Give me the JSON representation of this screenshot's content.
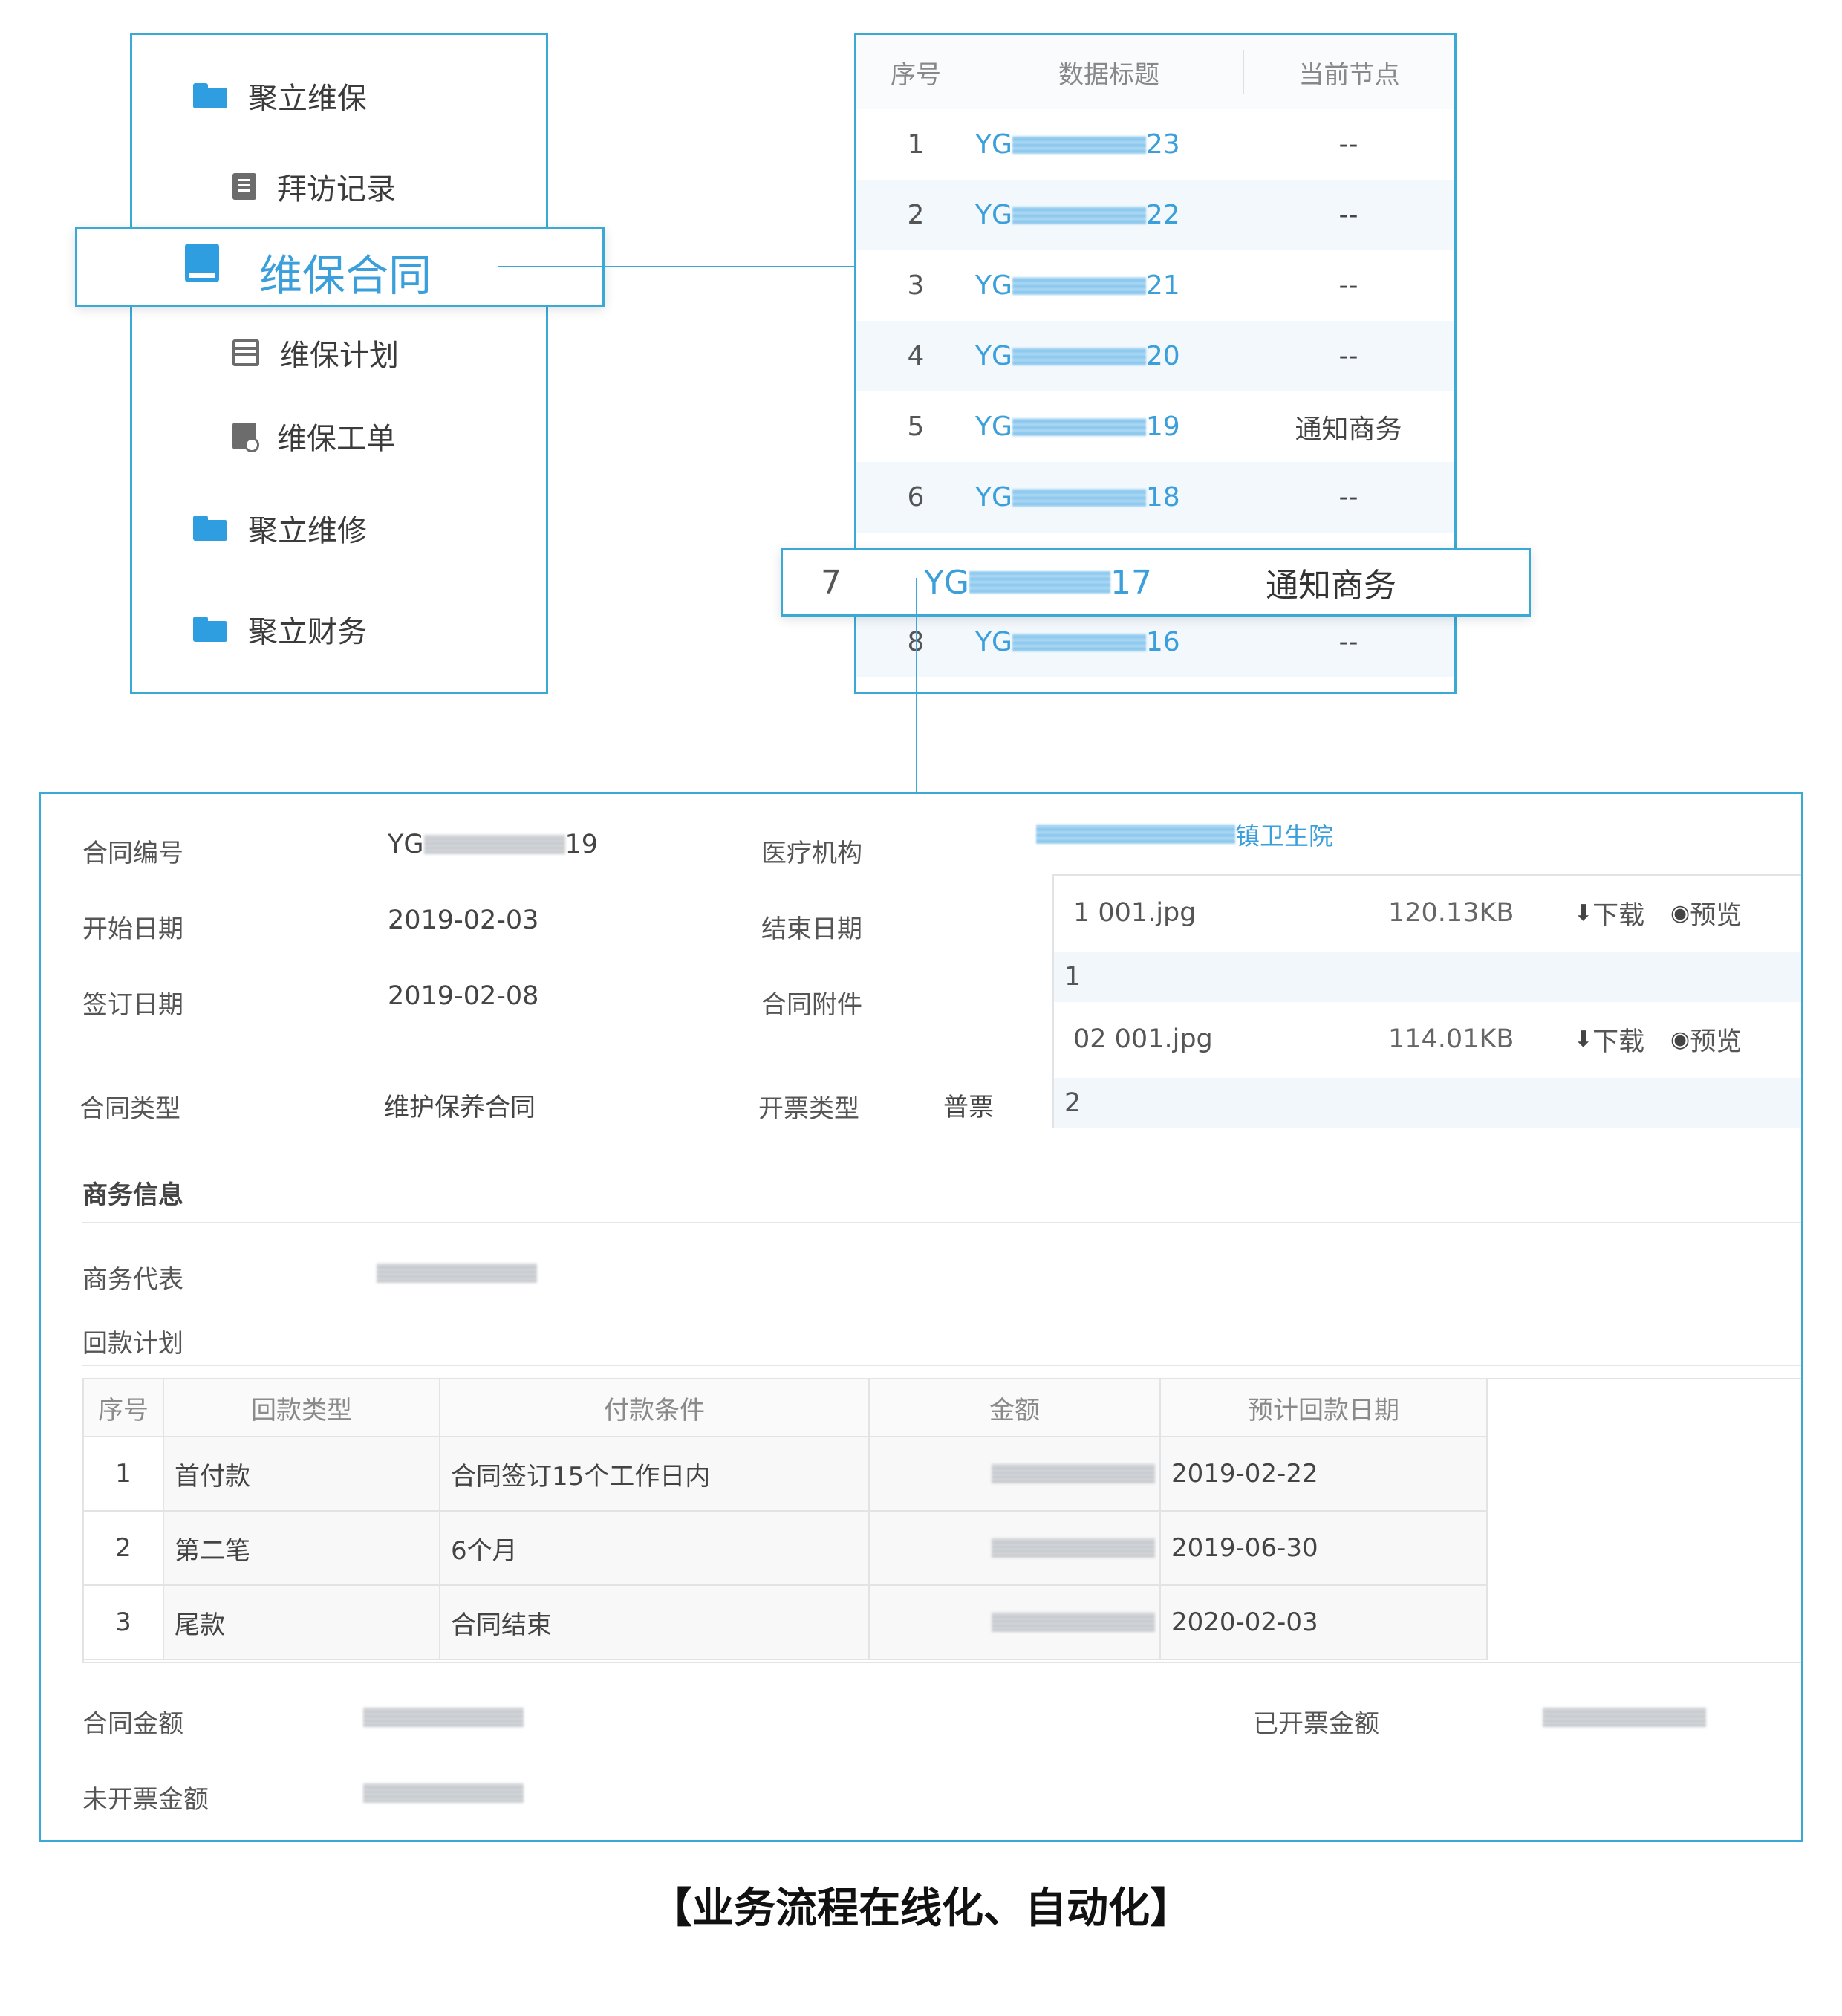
{
  "menu": {
    "items": [
      {
        "label": "聚立维保",
        "icon": "folder-icon"
      },
      {
        "label": "拜访记录",
        "icon": "document-icon"
      },
      {
        "label": "维保合同",
        "icon": "book-icon"
      },
      {
        "label": "维保计划",
        "icon": "plan-icon"
      },
      {
        "label": "维保工单",
        "icon": "work-order-icon"
      },
      {
        "label": "聚立维修",
        "icon": "folder-icon"
      },
      {
        "label": "聚立财务",
        "icon": "folder-icon"
      }
    ]
  },
  "list": {
    "headers": [
      "序号",
      "数据标题",
      "当前节点"
    ],
    "rows": [
      {
        "no": "1",
        "prefix": "YG",
        "suffix": "23",
        "node": "--"
      },
      {
        "no": "2",
        "prefix": "YG",
        "suffix": "22",
        "node": "--"
      },
      {
        "no": "3",
        "prefix": "YG",
        "suffix": "21",
        "node": "--"
      },
      {
        "no": "4",
        "prefix": "YG",
        "suffix": "20",
        "node": "--"
      },
      {
        "no": "5",
        "prefix": "YG",
        "suffix": "19",
        "node": "通知商务"
      },
      {
        "no": "6",
        "prefix": "YG",
        "suffix": "18",
        "node": "--"
      },
      {
        "no": "8",
        "prefix": "YG",
        "suffix": "16",
        "node": "--"
      }
    ],
    "highlight": {
      "no": "7",
      "prefix": "YG",
      "suffix": "17",
      "node": "通知商务"
    }
  },
  "detail": {
    "contract_no_label": "合同编号",
    "contract_no_prefix": "YG",
    "contract_no_suffix": "19",
    "institution_label": "医疗机构",
    "institution_value": "镇卫生院",
    "start_label": "开始日期",
    "start_value": "2019-02-03",
    "end_label": "结束日期",
    "sign_label": "签订日期",
    "sign_value": "2019-02-08",
    "attach_label": "合同附件",
    "type_label": "合同类型",
    "type_value": "维护保养合同",
    "invoice_type_label": "开票类型",
    "invoice_type_value": "普票",
    "attachments": [
      {
        "name": "1 001.jpg",
        "size": "120.13KB",
        "download": "下载",
        "preview": "预览",
        "index": "1"
      },
      {
        "name": "02 001.jpg",
        "size": "114.01KB",
        "download": "下载",
        "preview": "预览",
        "index": "2"
      }
    ],
    "business_section": "商务信息",
    "business_rep_label": "商务代表",
    "payment_plan_label": "回款计划",
    "payment_table": {
      "headers": [
        "序号",
        "回款类型",
        "付款条件",
        "金额",
        "预计回款日期"
      ],
      "rows": [
        {
          "no": "1",
          "type": "首付款",
          "condition": "合同签订15个工作日内",
          "date": "2019-02-22"
        },
        {
          "no": "2",
          "type": "第二笔",
          "condition": "6个月",
          "date": "2019-06-30"
        },
        {
          "no": "3",
          "type": "尾款",
          "condition": "合同结束",
          "date": "2020-02-03"
        }
      ]
    },
    "contract_amount_label": "合同金额",
    "invoiced_amount_label": "已开票金额",
    "uninvoiced_amount_label": "未开票金额"
  },
  "caption": "【业务流程在线化、自动化】",
  "colors": {
    "accent": "#3aa9d6",
    "link": "#3a9fdb",
    "folder": "#2f9ee0"
  }
}
